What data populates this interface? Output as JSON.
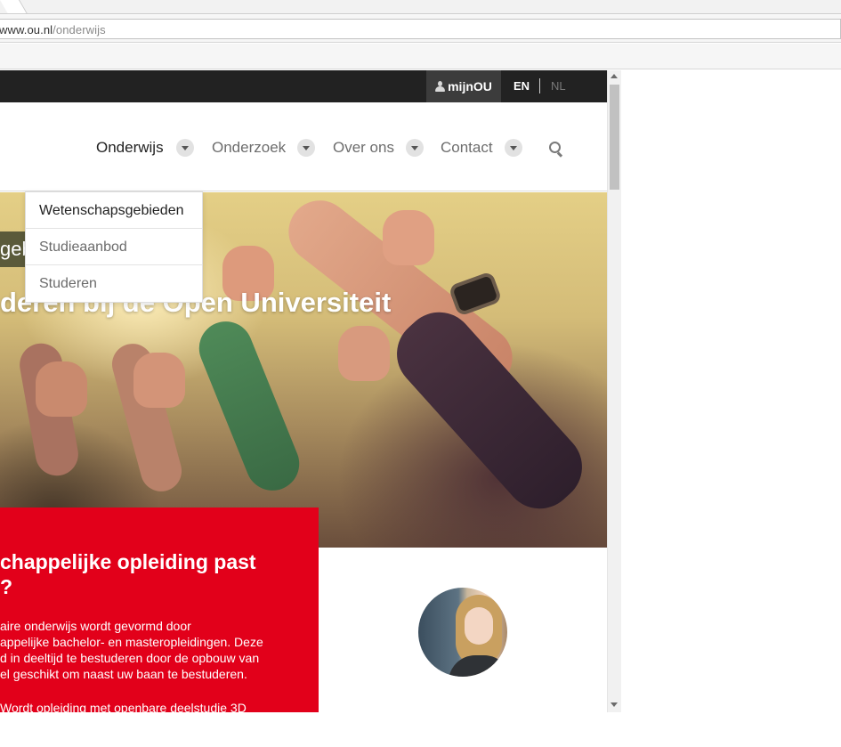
{
  "browser": {
    "url_host": "www.ou.nl",
    "url_path": "/onderwijs"
  },
  "topbar": {
    "account_label": "mijnOU",
    "lang_en": "EN",
    "lang_nl": "NL"
  },
  "nav": {
    "items": [
      {
        "label": "Onderwijs",
        "active": true
      },
      {
        "label": "Onderzoek",
        "active": false
      },
      {
        "label": "Over ons",
        "active": false
      },
      {
        "label": "Contact",
        "active": false
      }
    ]
  },
  "dropdown": {
    "items": [
      "Wetenschapsgebieden",
      "Studieaanbod",
      "Studeren"
    ]
  },
  "hero": {
    "tag": "geb",
    "title": "deren bij de Open Universiteit"
  },
  "promo": {
    "title_line1": "chappelijke opleiding past",
    "title_line2": "?",
    "body_line1": "aire onderwijs wordt gevormd door",
    "body_line2": "appelijke bachelor- en masteropleidingen. Deze",
    "body_line3": "d in deeltijd te bestuderen door de opbouw van",
    "body_line4": "el geschikt om naast uw baan te bestuderen.",
    "more": "Wordt opleiding met openbare deelstudie 3D"
  },
  "colors": {
    "topbar": "#222222",
    "promo_red": "#e2001a",
    "nav_text": "#6d6d6d"
  }
}
